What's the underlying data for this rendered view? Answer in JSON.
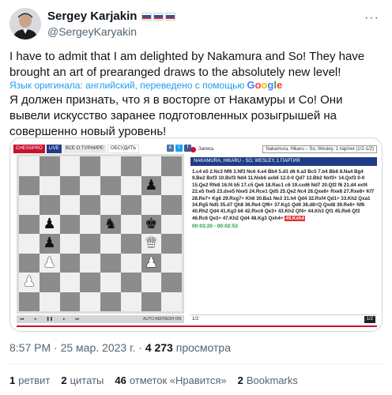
{
  "tweet": {
    "user": {
      "name": "Sergey Karjakin",
      "handle": "@SergeyKaryakin",
      "flag_count": 3
    },
    "text_en": "I have to admit that I am delighted by Nakamura and So! They have brought an art of prearanged draws to the absolutely new level!",
    "translated_label": "Язык оригинала: английский, переведено с помощью",
    "translator": "Google",
    "text_ru": "Я должен признать, что я в восторге от Накамуры и Со! Они вывели искусство заранее подготовленных розыгрышей на совершенно новый уровень!",
    "meta": {
      "time": "8:57 PM",
      "date": "25 мар. 2023 г.",
      "views_count": "4 273",
      "views_label": "просмотра"
    },
    "stats": [
      {
        "count": "1",
        "label": "ретвит"
      },
      {
        "count": "2",
        "label": "цитаты"
      },
      {
        "count": "46",
        "label": "отметок «Нравится»"
      },
      {
        "count": "2",
        "label": "Bookmarks"
      }
    ]
  },
  "embed": {
    "topbar": {
      "brand": "CHESSPRO",
      "live": "LIVE",
      "about": "ВСЕ О ТУРНИРЕ",
      "discuss": "ОБСУДИТЬ"
    },
    "board": [
      [
        "",
        "",
        "",
        "",
        "",
        "",
        "",
        ""
      ],
      [
        "",
        "",
        "",
        "",
        "",
        "",
        "bp",
        ""
      ],
      [
        "",
        "",
        "",
        "",
        "",
        "",
        "",
        ""
      ],
      [
        "",
        "bp",
        "",
        "",
        "bn",
        "",
        "bk",
        ""
      ],
      [
        "",
        "bp",
        "",
        "",
        "",
        "",
        "wq",
        ""
      ],
      [
        "",
        "wp",
        "",
        "",
        "",
        "",
        "wp",
        ""
      ],
      [
        "wp",
        "",
        "",
        "",
        "",
        "",
        "",
        ""
      ],
      [
        "",
        "",
        "",
        "",
        "",
        "",
        "",
        ""
      ]
    ],
    "piece_glyphs": {
      "wk": "♚",
      "wq": "♛",
      "wr": "♜",
      "wb": "♝",
      "wn": "♞",
      "wp": "♟",
      "bk": "♚",
      "bq": "♛",
      "br": "♜",
      "bb": "♝",
      "bn": "♞",
      "bp": "♟"
    },
    "controls": {
      "first": "◂◂",
      "prev": "◂",
      "pause": "❚❚",
      "next": "▸",
      "last": "▸▸",
      "auto_refresh": "AUTO REFRESH ON"
    },
    "panel": {
      "live_label": "Запись",
      "game_select": "Nakamura, Hikaru – So, Wesley, 1 партия (1/2-1/2)",
      "game_title": "NAKAMURA, HIKARU - SO, WESLEY, 1 ПАРТИЯ",
      "moves": "1.c4 e5 2.Nc3 Nf6 3.Nf3 Nc6 4.e4 Bb4 5.d3 d6 6.a3 Bc5 7.b4 Bb6 8.Na4 Bg4 9.Be2 Bxf3 10.Bxf3 Nd4 11.Nxb6 axb6 12.0-0 Qd7 13.Bb2 Nxf3+ 14.Qxf3 0-0 15.Qe2 Rfe8 16.f4 b5 17.c5 Qe6 18.Rac1 c6 19.cxd6 Nd7 20.Qf2 f6 21.d4 exf4 22.e5 fxe5 23.dxe5 Nxe5 24.Rce1 Qd5 25.Qe2 Nc4 26.Qxe8+ Rxe8 27.Rxe8+ Kf7 28.Re7+ Kg6 29.Rxg7+ Kh6 30.Ba1 Ne3 31.h4 Qd4 32.Rxf4 Qd1+ 33.Kh2 Qxa1 34.Rg5 Nd5 35.d7 Qh8 36.Re4 Qf6+ 37.Kg1 Qd6 38.d8=Q Qxd8 39.Re6+ Nf6 40.Rh2 Qd4 41.Kg3 b6 42.Rxc6 Qe3+ 43.Kh2 Qf4+ 44.Kh3 Qf1 45.Re6 Qf2 46.Rc6 Qe3+ 47.Kh2 Qd4 48.Kg3 Qxh4+",
      "last_move": "49.Kxh4",
      "clock": "00:03:20 - 00:02:53",
      "page_left": "1/2",
      "page_right": "1/2"
    }
  },
  "colors": {
    "accent": "#1d9bf0",
    "chesspro_red": "#c8102e",
    "chesspro_blue": "#1f3c88",
    "clock_green": "#1a9a3c"
  }
}
